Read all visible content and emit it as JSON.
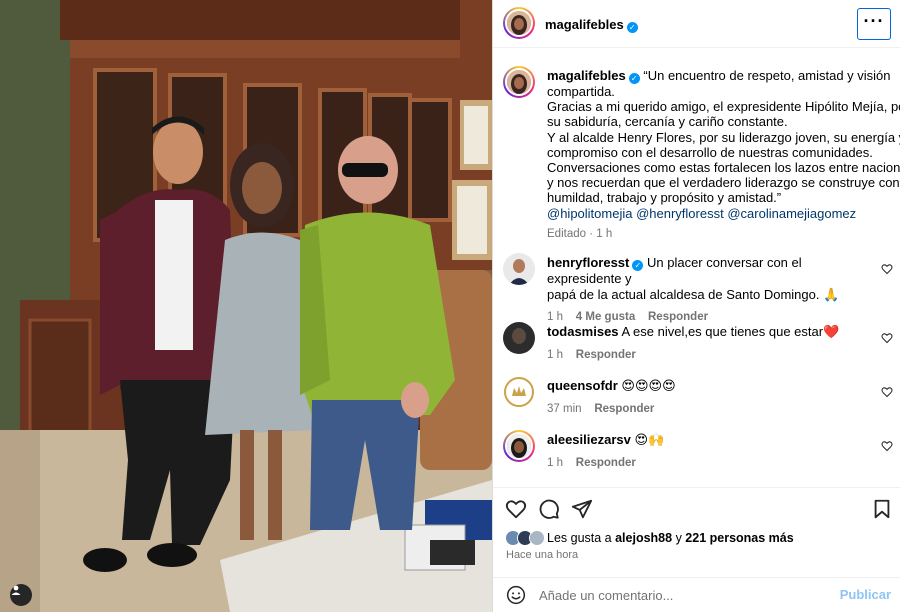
{
  "post": {
    "author": "magalifebles",
    "caption_lines": [
      "“Un encuentro de respeto, amistad y visión",
      "compartida.",
      "Gracias a mi querido amigo, el expresidente Hipólito Mejía, por",
      "su sabiduría, cercanía y cariño constante.",
      "Y al alcalde Henry Flores, por su liderazgo joven, su energía y",
      "compromiso con el desarrollo de nuestras comunidades.",
      "Conversaciones como estas fortalecen los lazos entre naciones",
      "y nos recuerdan que el verdadero liderazgo se construye con",
      "humildad, trabajo y propósito y amistad.”"
    ],
    "mentions": [
      "@hipolitomejia",
      "@henryfloresst",
      "@carolinamejiagomez"
    ],
    "caption_meta": "Editado · 1 h",
    "more_icon": "more-horizontal-icon"
  },
  "comments": [
    {
      "user": "henryfloresst",
      "verified": true,
      "text_lines": [
        "Un placer conversar con el expresidente y",
        "papá de la actual alcaldesa de Santo Domingo. 🙏"
      ],
      "time": "1 h",
      "likes": "4 Me gusta",
      "reply": "Responder"
    },
    {
      "user": "todasmises",
      "verified": false,
      "text_lines": [
        "A ese nivel,es que tienes que estar❤️"
      ],
      "time": "1 h",
      "likes": "",
      "reply": "Responder"
    },
    {
      "user": "queensofdr",
      "verified": false,
      "text_lines": [
        "😍😍😍😍"
      ],
      "time": "37 min",
      "likes": "",
      "reply": "Responder"
    },
    {
      "user": "aleesiliezarsv",
      "verified": false,
      "text_lines": [
        "😍🙌"
      ],
      "time": "1 h",
      "likes": "",
      "reply": "Responder"
    }
  ],
  "engagement": {
    "likes_prefix": "Les gusta a ",
    "likes_user": "alejosh88",
    "likes_mid": " y ",
    "likes_count": "221 personas más",
    "time": "Hace una hora"
  },
  "comment_box": {
    "placeholder": "Añade un comentario...",
    "publish": "Publicar"
  },
  "colors": {
    "link": "#00376b",
    "verified": "#0095f6",
    "publish_disabled": "#8fc4f4",
    "secondary_text": "#737373"
  }
}
